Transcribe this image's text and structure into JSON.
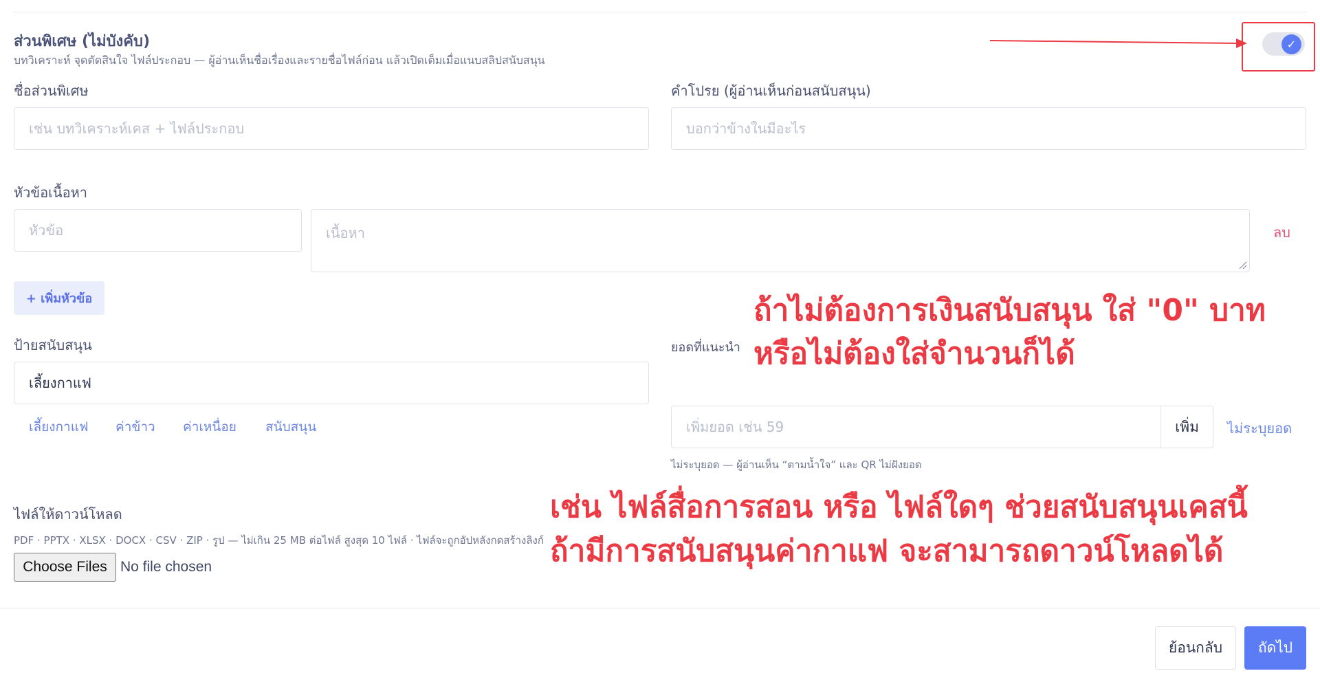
{
  "section": {
    "title": "ส่วนพิเศษ (ไม่บังคับ)",
    "description": "บทวิเคราะห์ จุดตัดสินใจ ไฟล์ประกอบ — ผู้อ่านเห็นชื่อเรื่องและรายชื่อไฟล์ก่อน แล้วเปิดเต็มเมื่อแนบสลิปสนับสนุน",
    "toggle_checked": true,
    "toggle_icon": "check-icon"
  },
  "fields": {
    "name_label": "ชื่อส่วนพิเศษ",
    "name_placeholder": "เช่น บทวิเคราะห์เคส + ไฟล์ประกอบ",
    "teaser_label": "คำโปรย (ผู้อ่านเห็นก่อนสนับสนุน)",
    "teaser_placeholder": "บอกว่าข้างในมีอะไร"
  },
  "topics": {
    "label": "หัวข้อเนื้อหา",
    "heading_placeholder": "หัวข้อ",
    "content_placeholder": "เนื้อหา",
    "delete_label": "ลบ",
    "add_label": "+ เพิ่มหัวข้อ"
  },
  "support": {
    "label": "ป้ายสนับสนุน",
    "value": "เลี้ยงกาแฟ",
    "chips": [
      "เลี้ยงกาแฟ",
      "ค่าข้าว",
      "ค่าเหนื่อย",
      "สนับสนุน"
    ]
  },
  "amount": {
    "label": "ยอดที่แนะนำ",
    "placeholder": "เพิ่มยอด เช่น 59",
    "add_label": "เพิ่ม",
    "unspecified_label": "ไม่ระบุยอด",
    "hint": "ไม่ระบุยอด — ผู้อ่านเห็น “ตามน้ำใจ” และ QR ไม่ฝังยอด"
  },
  "files": {
    "label": "ไฟล์ให้ดาวน์โหลด",
    "hint": "PDF · PPTX · XLSX · DOCX · CSV · ZIP · รูป — ไม่เกิน 25 MB ต่อไฟล์ สูงสุด 10 ไฟล์ · ไฟล์จะถูกอัปหลังกดสร้างลิงก์",
    "button_label": "Choose Files",
    "status": "No file chosen"
  },
  "annotations": {
    "amount_line1": "ถ้าไม่ต้องการเงินสนับสนุน ใส่ \"0\" บาท",
    "amount_line2": "หรือไม่ต้องใส่จำนวนก็ได้",
    "files_line1": "เช่น ไฟล์สื่อการสอน หรือ ไฟล์ใดๆ ช่วยสนับสนุนเคสนี้",
    "files_line2": "ถ้ามีการสนับสนุนค่ากาแฟ จะสามารถดาวน์โหลดได้",
    "color": "#ec3a44"
  },
  "footer": {
    "back_label": "ย้อนกลับ",
    "next_label": "ถัดไป"
  },
  "colors": {
    "accent": "#5b7cf5",
    "link": "#6c86e5",
    "danger": "#e0527a"
  }
}
